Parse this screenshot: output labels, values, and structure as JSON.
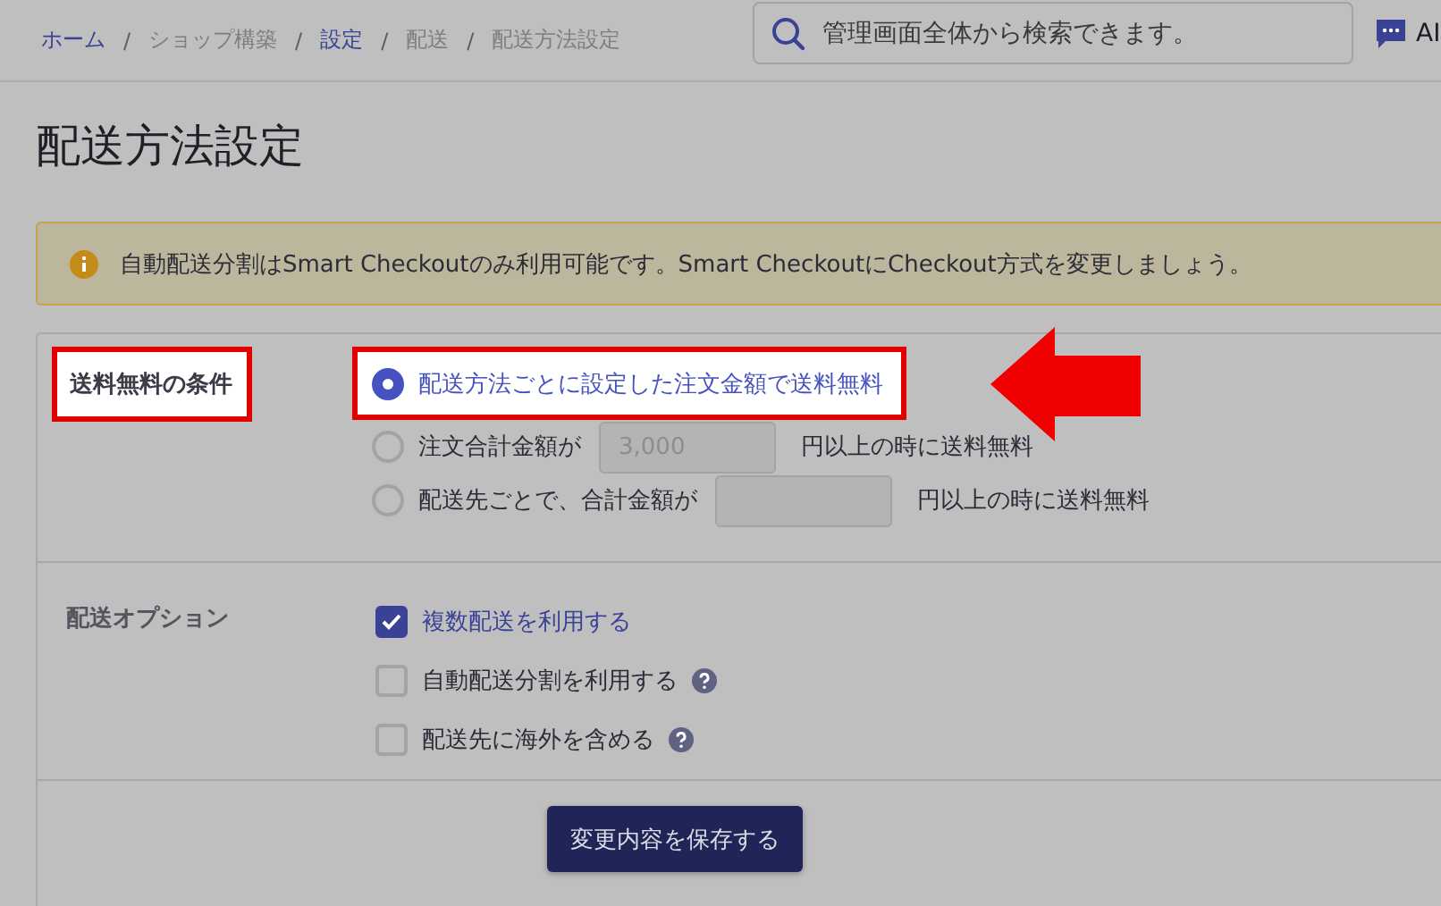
{
  "breadcrumb": [
    {
      "label": "ホーム",
      "link": true
    },
    {
      "separator": "/",
      "label": "ショップ構築",
      "link": false
    },
    {
      "separator": "/",
      "label": "設定",
      "link": true
    },
    {
      "separator": "/",
      "label": "配送",
      "link": false
    },
    {
      "separator": "/",
      "label": "配送方法設定",
      "link": false
    }
  ],
  "search": {
    "placeholder": "管理画面全体から検索できます。"
  },
  "ai_button": {
    "label": "AI"
  },
  "page_title": "配送方法設定",
  "alert": {
    "text": "自動配送分割はSmart Checkoutのみ利用可能です。Smart CheckoutにCheckout方式を変更しましょう。"
  },
  "free_shipping": {
    "label": "送料無料の条件",
    "highlighted": true,
    "options": [
      {
        "kind": "plain",
        "label": "配送方法ごとに設定した注文金額で送料無料",
        "selected": true,
        "highlighted": true
      },
      {
        "kind": "amount",
        "label": "注文合計金額が",
        "value": "3,000",
        "disabled": true,
        "suffix": "円以上の時に送料無料",
        "selected": false,
        "highlighted": false
      },
      {
        "kind": "amount",
        "label": "配送先ごとで、合計金額が",
        "disabled": true,
        "suffix": "円以上の時に送料無料",
        "selected": false,
        "highlighted": false
      }
    ]
  },
  "shipping_options": {
    "label": "配送オプション",
    "options": [
      {
        "label": "複数配送を利用する",
        "checked": true,
        "help": false
      },
      {
        "label": "自動配送分割を利用する",
        "checked": false,
        "help": true
      },
      {
        "label": "配送先に海外を含める",
        "checked": false,
        "help": true
      }
    ]
  },
  "save_button": {
    "label": "変更内容を保存する"
  }
}
